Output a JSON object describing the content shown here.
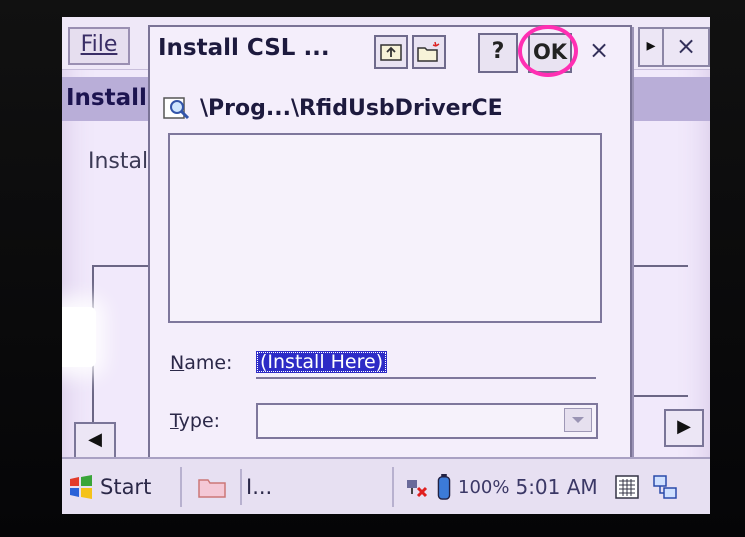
{
  "background_app": {
    "file_menu": "File",
    "header_text": "Installi",
    "body_text": "Instal"
  },
  "dialog": {
    "title": "Install CSL ...",
    "help_label": "?",
    "ok_label": "OK",
    "close_label": "×",
    "path": "\\Prog...\\RfidUsbDriverCE",
    "name_label": "Name:",
    "name_value": "(Install Here)",
    "type_label": "Type:",
    "type_value": ""
  },
  "taskbar": {
    "start_label": "Start",
    "app_label": "I...",
    "battery": "100%",
    "time": "5:01 AM"
  },
  "colors": {
    "screen_bg": "#f1e9fb",
    "highlight_circle": "#ff2fb3",
    "selection": "#2d2bc6",
    "header": "#b9aed8"
  }
}
